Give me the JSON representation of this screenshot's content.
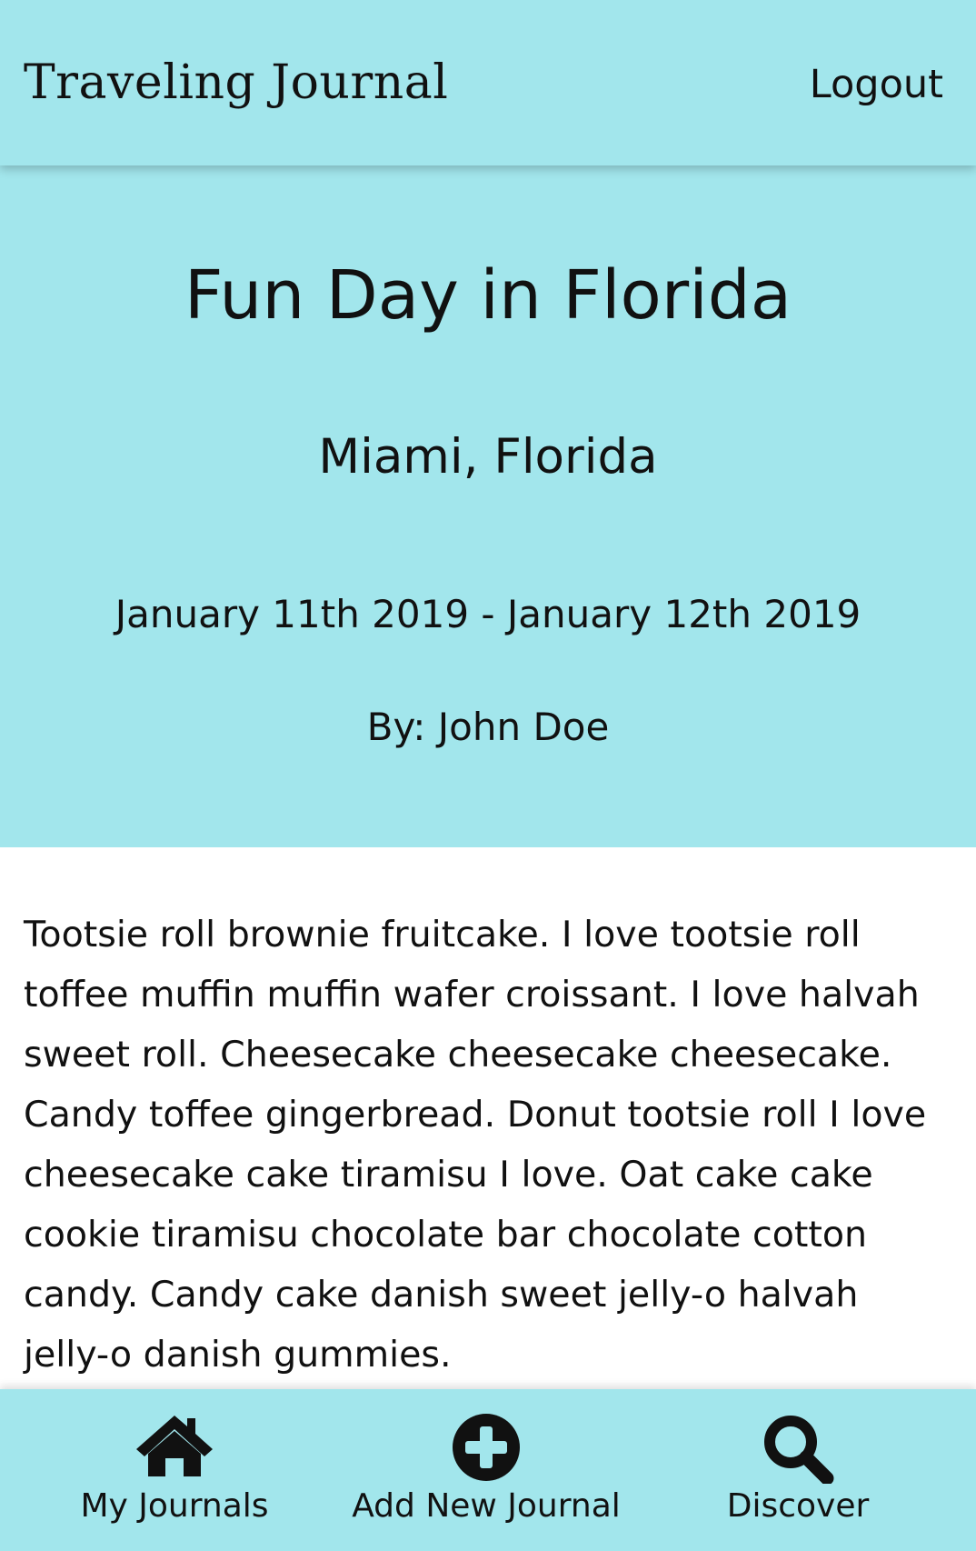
{
  "header": {
    "app_title": "Traveling Journal",
    "logout_label": "Logout"
  },
  "journal": {
    "title": "Fun Day in Florida",
    "location": "Miami, Florida",
    "dates": "January 11th 2019 - January 12th 2019",
    "author": "By: John Doe",
    "body": "Tootsie roll brownie fruitcake. I love tootsie roll toffee muffin muffin wafer croissant. I love halvah sweet roll. Cheesecake cheesecake cheesecake. Candy toffee gingerbread. Donut tootsie roll I love cheesecake cake tiramisu I love. Oat cake cake cookie tiramisu chocolate bar chocolate cotton candy. Candy cake danish sweet jelly-o halvah jelly-o danish gummies."
  },
  "bottom_nav": {
    "items": [
      {
        "label": "My Journals",
        "icon": "home-icon"
      },
      {
        "label": "Add New Journal",
        "icon": "plus-circle-icon"
      },
      {
        "label": "Discover",
        "icon": "search-icon"
      }
    ]
  },
  "colors": {
    "accent_background": "#a2e6ec",
    "text": "#111111",
    "page_background": "#ffffff"
  }
}
